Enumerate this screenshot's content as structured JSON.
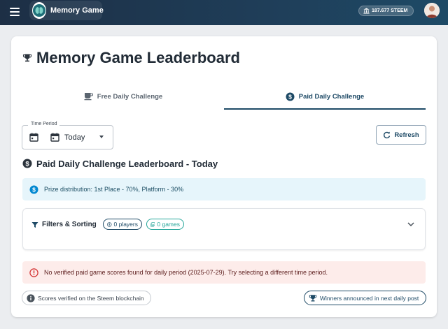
{
  "header": {
    "app_name": "Memory Game",
    "wallet_balance": "187.677 STEEM",
    "menu_icon": "hamburger-menu-icon",
    "logo_icon": "brain-logo-icon",
    "wallet_icon": "bank-icon"
  },
  "page": {
    "title": "Memory Game Leaderboard",
    "title_icon": "trophy-icon"
  },
  "tabs": [
    {
      "label": "Free Daily Challenge",
      "icon": "coffee-icon",
      "selected": false
    },
    {
      "label": "Paid Daily Challenge",
      "icon": "dollar-circle-icon",
      "selected": true
    }
  ],
  "time_period": {
    "legend": "Time Period",
    "value": "Today"
  },
  "refresh": {
    "label": "Refresh"
  },
  "leaderboard": {
    "title": "Paid Daily Challenge Leaderboard - Today"
  },
  "prize_alert": {
    "text": "Prize distribution: 1st Place - 70%, Platform - 30%"
  },
  "filters": {
    "label": "Filters & Sorting",
    "players_chip": "0 players",
    "games_chip": "0 games"
  },
  "error_alert": {
    "text": "No verified paid game scores found for daily period (2025-07-29). Try selecting a different time period."
  },
  "footer": {
    "verified_chip": "Scores verified on the Steem blockchain",
    "winners_chip": "Winners announced in next daily post"
  },
  "colors": {
    "brand": "#1e4a66",
    "info_bg": "#e6f5fb",
    "error_bg": "#fdecea",
    "games_accent": "#26a69a"
  }
}
